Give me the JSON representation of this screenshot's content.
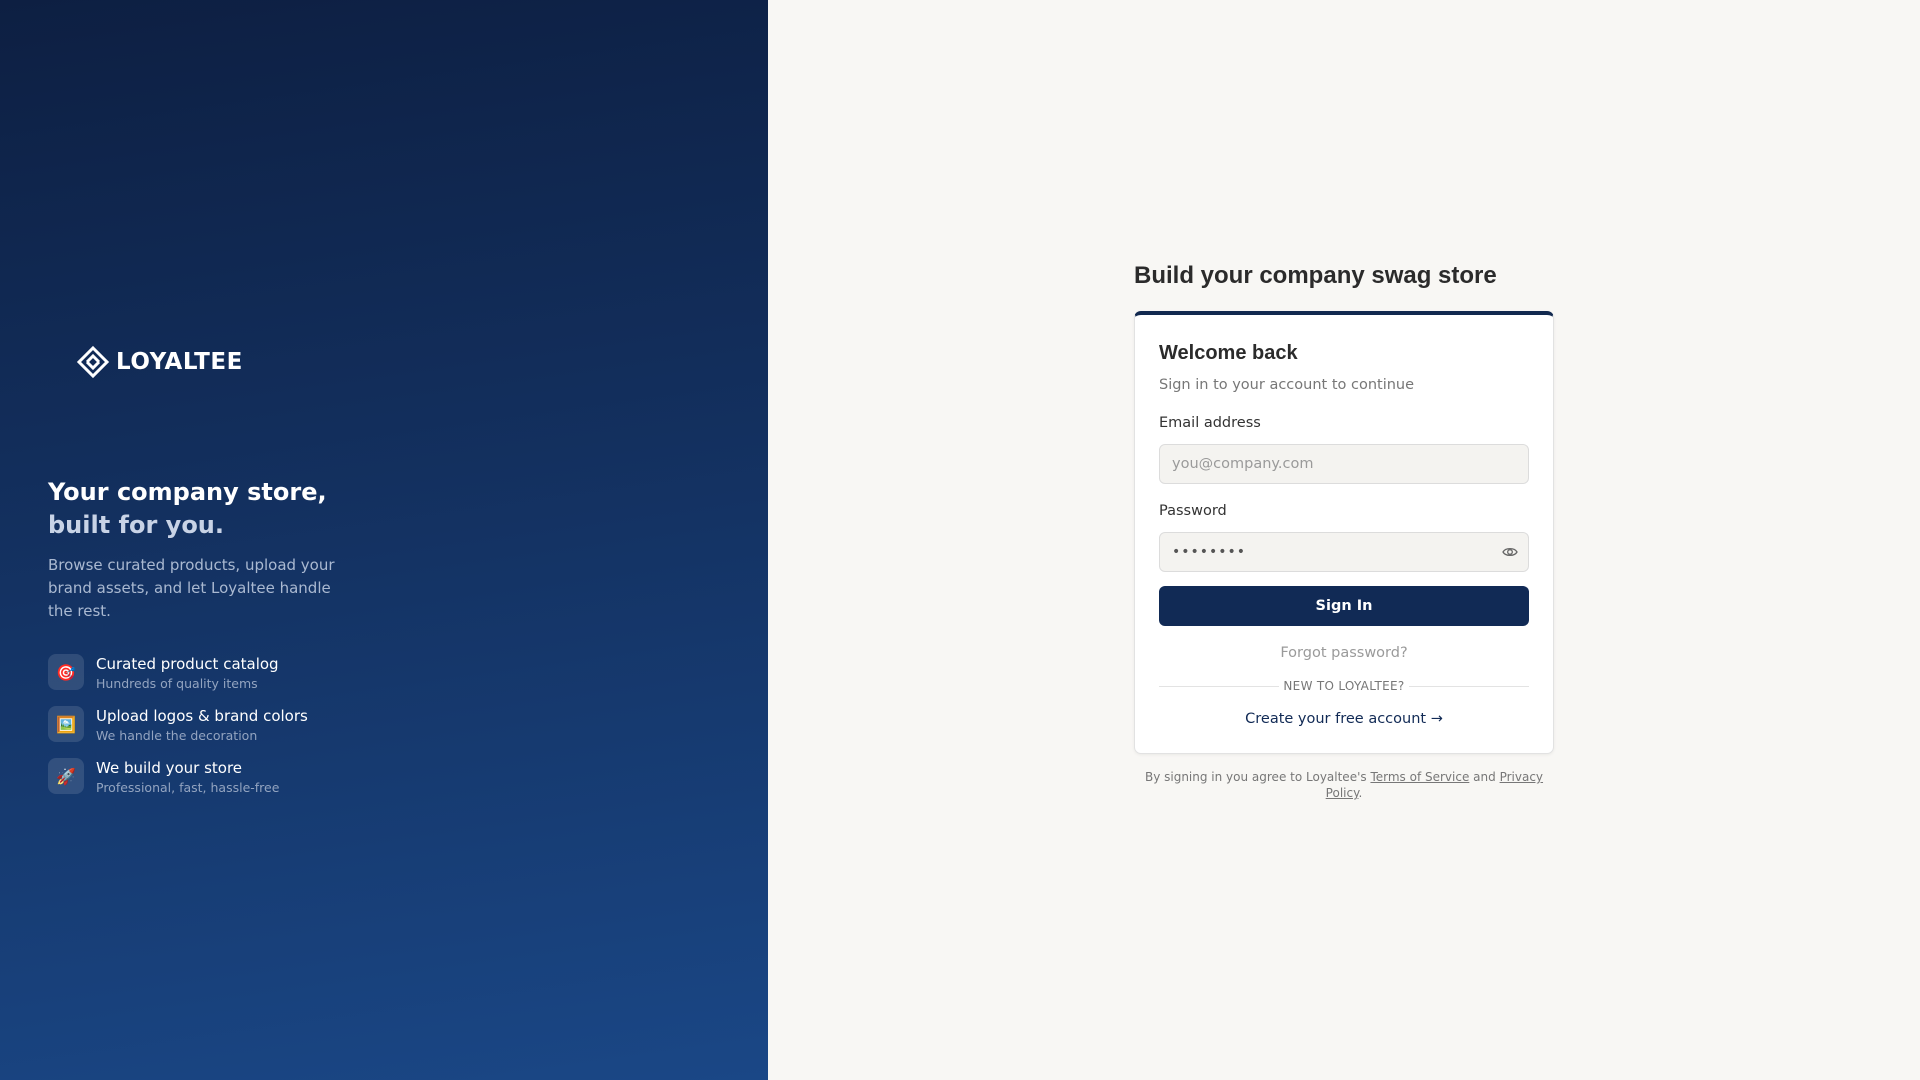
{
  "brand": {
    "name": "LOYALTEE",
    "colors": {
      "navy": "#112a55",
      "hero_top": "#0d1f42",
      "hero_bottom": "#1a4786",
      "background": "#f8f7f4"
    }
  },
  "hero": {
    "heading_line1": "Your company store,",
    "heading_line2": "built for you.",
    "description": "Browse curated products, upload your brand assets, and let Loyaltee handle the rest.",
    "features": [
      {
        "icon": "target-icon",
        "glyph": "🎯",
        "title": "Curated product catalog",
        "subtitle": "Hundreds of quality items"
      },
      {
        "icon": "framed-picture-icon",
        "glyph": "🖼️",
        "title": "Upload logos & brand colors",
        "subtitle": "We handle the decoration"
      },
      {
        "icon": "rocket-icon",
        "glyph": "🚀",
        "title": "We build your store",
        "subtitle": "Professional, fast, hassle-free"
      }
    ]
  },
  "main": {
    "page_title": "Build your company swag store",
    "card": {
      "title": "Welcome back",
      "subtitle": "Sign in to your account to continue",
      "email_label": "Email address",
      "email_placeholder": "you@company.com",
      "email_value": "",
      "password_label": "Password",
      "password_value": "••••••••",
      "password_toggle_icon": "eye-icon",
      "signin_label": "Sign In",
      "forgot_label": "Forgot password?",
      "divider_text": "NEW TO LOYALTEE?",
      "create_label": "Create your free account →"
    },
    "legal": {
      "prefix": "By signing in you agree to Loyaltee's",
      "terms": "Terms of Service",
      "and": "and",
      "privacy": "Privacy Policy",
      "suffix": "."
    }
  }
}
